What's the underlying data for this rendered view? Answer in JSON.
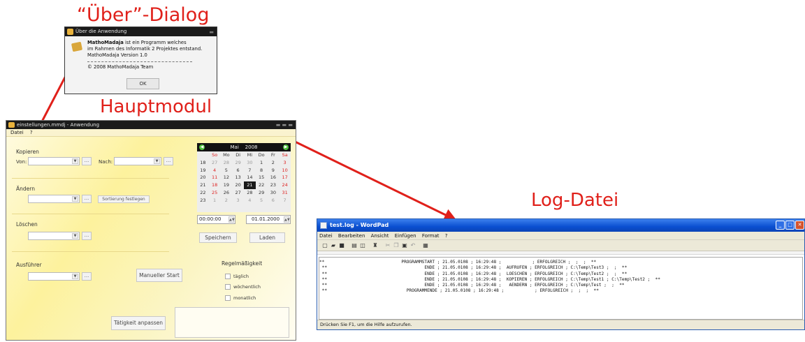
{
  "annotations": {
    "about_label": "“Über”-Dialog",
    "main_label": "Hauptmodul",
    "log_label": "Log-Datei",
    "color": "#e0201a"
  },
  "about_dialog": {
    "title": "Über die Anwendung",
    "app_name": "MathoMadaja",
    "line1_rest": " ist ein Programm welches",
    "line2": "im Rahmen des Informatik 2 Projektes entstand.",
    "line3": "MathoMadaja Version 1.0",
    "copyright": "© 2008 MathoMadaja Team",
    "ok_label": "OK"
  },
  "main_window": {
    "title": "einstellungen.mmdj - Anwendung",
    "menu": [
      "Datei",
      "?"
    ],
    "sections": {
      "kopieren": "Kopieren",
      "von": "Von:",
      "nach": "Nach:",
      "aendern": "Ändern",
      "sortierung_button": "Sortierung festlegen",
      "loeschen": "Löschen",
      "ausfuehrer": "Ausführer",
      "manueller_start": "Manueller Start",
      "regelmaessigkeit": "Regelmäßigkeit",
      "taeglich": "täglich",
      "woechentlich": "wöchentlich",
      "monatlich": "monatlich",
      "taetigkeit_button": "Tätigkeit anpassen",
      "dots": "..."
    },
    "calendar": {
      "month": "Mai",
      "year": "2008",
      "header": [
        "",
        "So",
        "Mo",
        "Di",
        "Mi",
        "Do",
        "Fr",
        "Sa"
      ],
      "weeks": [
        [
          "18",
          "27",
          "28",
          "29",
          "30",
          "1",
          "2",
          "3"
        ],
        [
          "19",
          "4",
          "5",
          "6",
          "7",
          "8",
          "9",
          "10"
        ],
        [
          "20",
          "11",
          "12",
          "13",
          "14",
          "15",
          "16",
          "17"
        ],
        [
          "21",
          "18",
          "19",
          "20",
          "21",
          "22",
          "23",
          "24"
        ],
        [
          "22",
          "25",
          "26",
          "27",
          "28",
          "29",
          "30",
          "31"
        ],
        [
          "23",
          "1",
          "2",
          "3",
          "4",
          "5",
          "6",
          "7"
        ]
      ],
      "selected_day": "21"
    },
    "time_value": "00:00:00",
    "date_value": "01.01.2000",
    "speichern": "Speichern",
    "laden": "Laden"
  },
  "wordpad": {
    "title": "test.log - WordPad",
    "menu": [
      "Datei",
      "Bearbeiten",
      "Ansicht",
      "Einfügen",
      "Format",
      "?"
    ],
    "log_lines": [
      "**                              PROGRAMMSTART ; 21.05.0108 ; 16:29:48 ;            ; ERFOLGREICH ;  ;  ;  **",
      " **                                      ENDE ; 21.05.0108 ; 16:29:48 ;  AUFRUFEN ; ERFOLGREICH ; C:\\Temp\\Test3 ;  ;  **",
      " **                                      ENDE ; 21.05.0108 ; 16:29:48 ;  LOESCHEN ; ERFOLGREICH ; C:\\Temp\\Test2 ;  ;  **",
      " **                                      ENDE ; 21.05.0108 ; 16:29:48 ;  KOPIEREN ; ERFOLGREICH ; C:\\Temp\\Test1 ; C:\\Temp\\Test2 ;  **",
      " **                                      ENDE ; 21.05.0108 ; 16:29:48 ;   AENDERN ; ERFOLGREICH ; C:\\Temp\\Test ;  ;  **",
      " **                               PROGRAMMENDE ; 21.05.0108 ; 16:29:48 ;            ; ERFOLGREICH ;  ;  ;  **"
    ],
    "status": "Drücken Sie F1, um die Hilfe aufzurufen."
  }
}
